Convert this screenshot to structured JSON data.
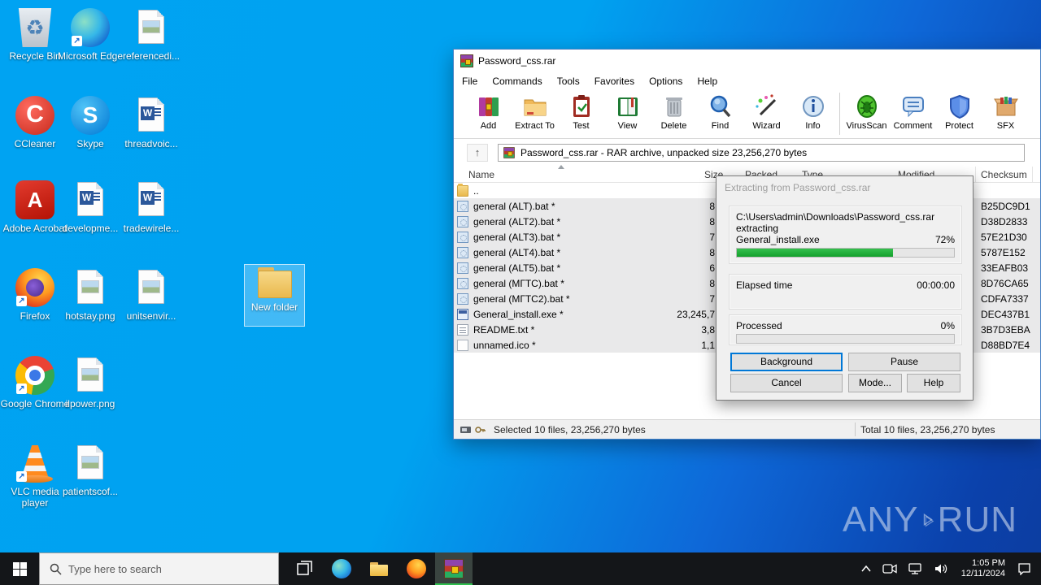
{
  "desktop": {
    "icons": [
      {
        "label": "Recycle Bin",
        "kind": "recycle"
      },
      {
        "label": "Microsoft Edge",
        "kind": "edge"
      },
      {
        "label": "referencedi...",
        "kind": "image"
      },
      {
        "label": "CCleaner",
        "kind": "ccleaner"
      },
      {
        "label": "Skype",
        "kind": "skype"
      },
      {
        "label": "threadvoic...",
        "kind": "word"
      },
      {
        "label": "Adobe Acrobat",
        "kind": "acrobat"
      },
      {
        "label": "developme...",
        "kind": "word"
      },
      {
        "label": "tradewirele...",
        "kind": "word"
      },
      {
        "label": "Firefox",
        "kind": "firefox"
      },
      {
        "label": "hotstay.png",
        "kind": "image"
      },
      {
        "label": "unitsenvir...",
        "kind": "image"
      },
      {
        "label": "Google Chrome",
        "kind": "chrome"
      },
      {
        "label": "ilpower.png",
        "kind": "image"
      },
      {
        "label": "VLC media player",
        "kind": "vlc"
      },
      {
        "label": "patientscof...",
        "kind": "image"
      }
    ],
    "new_folder_label": "New folder",
    "skype_letter": "S",
    "ccleaner_letter": "C",
    "acrobat_letter": "A",
    "recycle_glyph": "♻",
    "word_letter": "W"
  },
  "watermark": {
    "left": "ANY",
    "right": "RUN"
  },
  "winrar": {
    "title": "Password_css.rar",
    "menu": [
      "File",
      "Commands",
      "Tools",
      "Favorites",
      "Options",
      "Help"
    ],
    "toolbar": [
      "Add",
      "Extract To",
      "Test",
      "View",
      "Delete",
      "Find",
      "Wizard",
      "Info",
      "VirusScan",
      "Comment",
      "Protect",
      "SFX"
    ],
    "up_glyph": "↑",
    "address": "Password_css.rar - RAR archive, unpacked size 23,256,270 bytes",
    "columns": {
      "name": "Name",
      "size": "Size",
      "packed": "Packed",
      "type": "Type",
      "modified": "Modified",
      "checksum": "Checksum"
    },
    "files": [
      {
        "name": "..",
        "size": "",
        "checksum": ""
      },
      {
        "name": "general (ALT).bat *",
        "size": "8",
        "checksum": "B25DC9D1"
      },
      {
        "name": "general (ALT2).bat *",
        "size": "8",
        "checksum": "D38D2833"
      },
      {
        "name": "general (ALT3).bat *",
        "size": "7",
        "checksum": "57E21D30"
      },
      {
        "name": "general (ALT4).bat *",
        "size": "8",
        "checksum": "5787E152"
      },
      {
        "name": "general (ALT5).bat *",
        "size": "6",
        "checksum": "33EAFB03"
      },
      {
        "name": "general (МГТС).bat *",
        "size": "8",
        "checksum": "8D76CA65"
      },
      {
        "name": "general (МГТС2).bat *",
        "size": "7",
        "checksum": "CDFA7337"
      },
      {
        "name": "General_install.exe *",
        "size": "23,245,7",
        "checksum": "DEC437B1"
      },
      {
        "name": "README.txt *",
        "size": "3,8",
        "checksum": "3B7D3EBA"
      },
      {
        "name": "unnamed.ico *",
        "size": "1,1",
        "checksum": "D88BD7E4"
      }
    ],
    "status_left": "Selected 10 files, 23,256,270 bytes",
    "status_right": "Total 10 files, 23,256,270 bytes"
  },
  "dialog": {
    "title": "Extracting from Password_css.rar",
    "archive_path": "C:\\Users\\admin\\Downloads\\Password_css.rar",
    "action": "extracting",
    "current_file": "General_install.exe",
    "current_percent": "72%",
    "progress_value": 72,
    "elapsed_label": "Elapsed time",
    "elapsed_value": "00:00:00",
    "processed_label": "Processed",
    "processed_percent": "0%",
    "processed_value": 0,
    "buttons": {
      "background": "Background",
      "pause": "Pause",
      "cancel": "Cancel",
      "mode": "Mode...",
      "help": "Help"
    }
  },
  "taskbar": {
    "search_placeholder": "Type here to search",
    "time": "1:05 PM",
    "date": "12/11/2024"
  }
}
